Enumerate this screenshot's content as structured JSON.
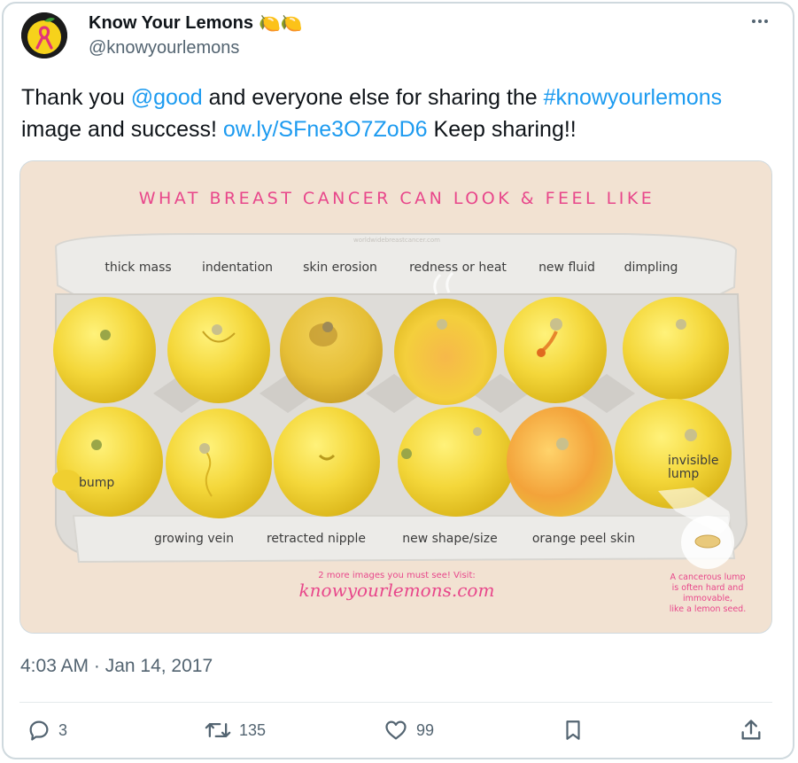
{
  "author": {
    "name": "Know Your Lemons",
    "name_emoji": "🍋🍋",
    "handle": "@knowyourlemons",
    "avatar": "pink-ribbon-lemon-logo"
  },
  "tweet": {
    "text_1": "Thank you ",
    "mention": "@good",
    "text_2": " and everyone else for sharing the ",
    "hashtag": "#knowyourlemons",
    "text_3": "image and success! ",
    "link": "ow.ly/SFne3O7ZoD6",
    "text_4": " Keep sharing!!"
  },
  "image": {
    "title": "WHAT BREAST CANCER CAN LOOK & FEEL LIKE",
    "watermark": "worldwidebreastcancer.com",
    "top_labels": [
      "thick mass",
      "indentation",
      "skin erosion",
      "redness or heat",
      "new fluid",
      "dimpling"
    ],
    "bottom_labels": [
      "growing vein",
      "retracted nipple",
      "new shape/size",
      "orange peel skin"
    ],
    "side_labels": {
      "bump": "bump",
      "invisible_1": "invisible",
      "invisible_2": "lump"
    },
    "promo_line": "2 more images you must see! Visit:",
    "promo_url": "knowyourlemons.com",
    "seed_note": [
      "A cancerous lump",
      "is often hard and",
      "immovable,",
      "like a lemon seed."
    ],
    "colors": {
      "title_pink": "#e8478b",
      "lemon": "#f4d73a",
      "carton": "#e9e6e1",
      "background": "#f2e2d2"
    }
  },
  "timestamp": "4:03 AM · Jan 14, 2017",
  "actions": {
    "reply": {
      "icon": "reply-icon",
      "count": "3"
    },
    "retweet": {
      "icon": "retweet-icon",
      "count": "135"
    },
    "like": {
      "icon": "heart-icon",
      "count": "99"
    },
    "bookmark": {
      "icon": "bookmark-icon"
    },
    "share": {
      "icon": "share-icon"
    }
  }
}
